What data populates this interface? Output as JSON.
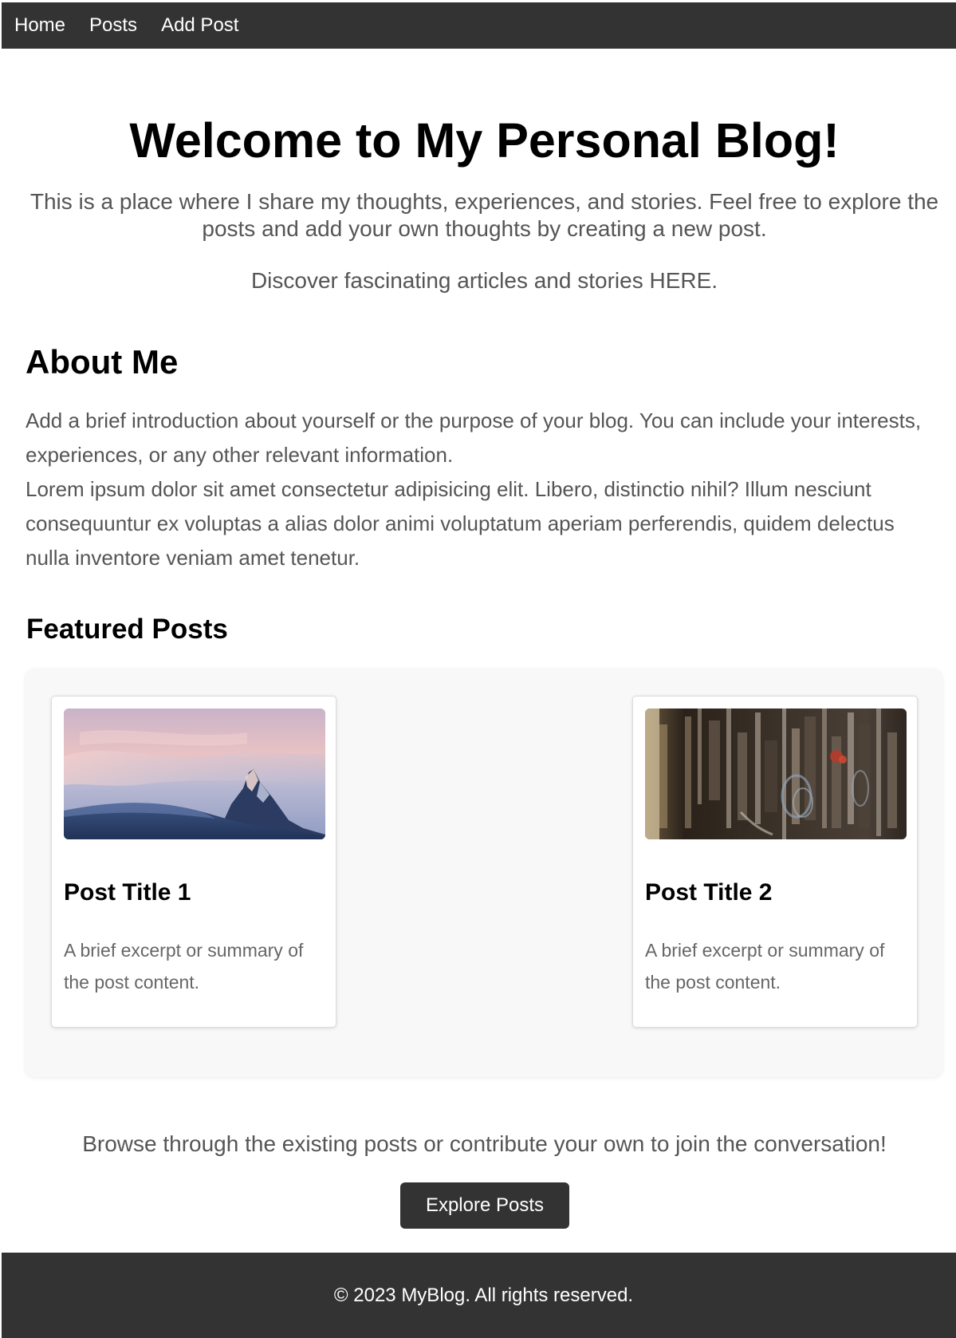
{
  "nav": {
    "items": [
      {
        "label": "Home"
      },
      {
        "label": "Posts"
      },
      {
        "label": "Add Post"
      }
    ]
  },
  "hero": {
    "title": "Welcome to My Personal Blog!",
    "intro": "This is a place where I share my thoughts, experiences, and stories. Feel free to explore the posts and add your own thoughts by creating a new post.",
    "cta": "Discover fascinating articles and stories HERE."
  },
  "about": {
    "heading": "About Me",
    "paragraph_1": "Add a brief introduction about yourself or the purpose of your blog. You can include your interests, experiences, or any other relevant information.",
    "paragraph_2": "Lorem ipsum dolor sit amet consectetur adipisicing elit. Libero, distinctio nihil? Illum nesciunt consequuntur ex voluptas a alias dolor animi voluptatum aperiam perferendis, quidem delectus nulla inventore veniam amet tenetur."
  },
  "featured": {
    "heading": "Featured Posts",
    "posts": [
      {
        "title": "Post Title 1",
        "excerpt": "A brief excerpt or summary of the post content.",
        "image": "mountain-photo"
      },
      {
        "title": "Post Title 2",
        "excerpt": "A brief excerpt or summary of the post content.",
        "image": "hanging-tools-photo"
      }
    ]
  },
  "browse": {
    "text": "Browse through the existing posts or contribute your own to join the conversation!",
    "button_label": "Explore Posts"
  },
  "footer": {
    "text": "© 2023 MyBlog. All rights reserved."
  },
  "colors": {
    "nav_background": "#333333",
    "footer_background": "#333333",
    "button_background": "#333333",
    "body_text": "#555555",
    "heading_text": "#000000"
  }
}
